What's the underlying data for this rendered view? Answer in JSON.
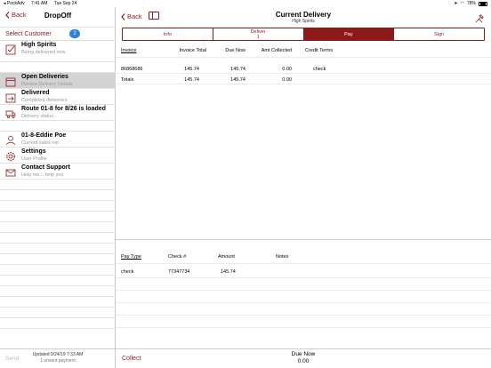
{
  "status": {
    "carrier": "◂ PockAdv",
    "time": "7:41 AM",
    "date": "Tue Sep 24",
    "battery": "78%"
  },
  "sidebar": {
    "back_label": "Back",
    "title": "DropOff",
    "select_customer": {
      "label": "Select Customer",
      "count": "2"
    },
    "items": [
      {
        "title": "High Spirits",
        "subtitle": "Being delivered now",
        "icon": "checkbox-icon"
      },
      {
        "title": "Open Deliveries",
        "subtitle": "Review Delivery Details",
        "icon": "box-icon"
      },
      {
        "title": "Delivered",
        "subtitle": "Completed deliveries",
        "icon": "box-arrow-icon"
      },
      {
        "title": "Route 01-8 for 8/26 is loaded",
        "subtitle": "Delivery status",
        "icon": "truck-icon"
      },
      {
        "title": "01-8-Eddie Poe",
        "subtitle": "Current sales rep",
        "icon": "person-icon"
      },
      {
        "title": "Settings",
        "subtitle": "User Profile",
        "icon": "gear-icon"
      },
      {
        "title": "Contact Support",
        "subtitle": "Help me... help you",
        "icon": "envelope-icon"
      }
    ],
    "footer": {
      "send": "Send",
      "updated_line": "Updated  9/24/19  7:33 AM",
      "unsent_line": "1 unsent payment"
    }
  },
  "main": {
    "back_label": "Back",
    "title": "Current Delivery",
    "subtitle": "High Spirits",
    "tabs": [
      {
        "label": "Info"
      },
      {
        "label": "Deliver",
        "sub": "1"
      },
      {
        "label": "Pay"
      },
      {
        "label": "Sign"
      }
    ],
    "invoice_headers": [
      "Invoice",
      "Invoice Total",
      "Due Now",
      "Amt Collected",
      "Credit Terms"
    ],
    "invoice_rows": [
      [
        "86868686",
        "145.74",
        "145.74",
        "0.00",
        "check"
      ],
      [
        "Totals",
        "145.74",
        "145.74",
        "0.00",
        ""
      ]
    ],
    "payment_headers": [
      "Pay Type",
      "Check #",
      "Amount",
      "Notes"
    ],
    "payment_rows": [
      [
        "check",
        "77347734",
        "145.74",
        ""
      ]
    ],
    "footer": {
      "collect": "Collect",
      "due_label": "Due Now",
      "due_value": "0.00"
    }
  },
  "colors": {
    "accent": "#8b1a1a",
    "badge": "#2a7fe0",
    "selected_row": "#d3d3d3"
  }
}
